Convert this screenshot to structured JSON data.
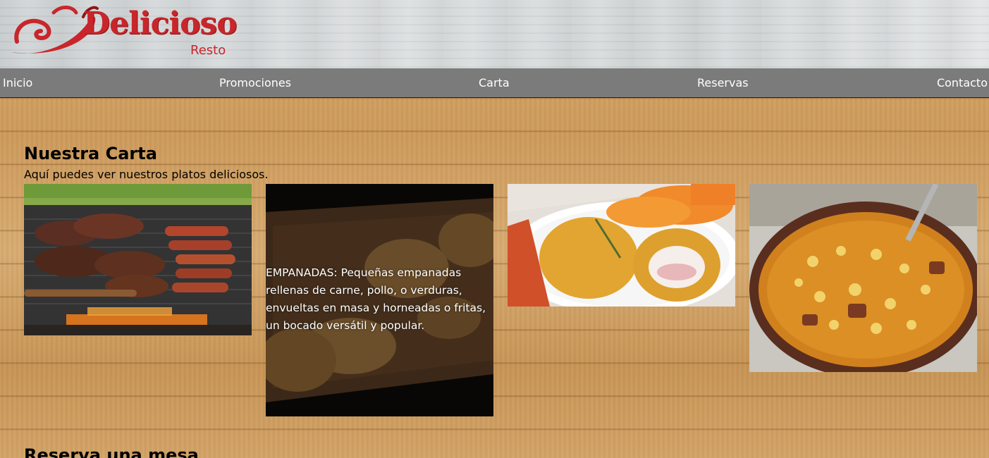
{
  "brand": {
    "name": "Delicioso",
    "tagline": "Resto",
    "color": "#c8262b"
  },
  "nav": {
    "items": [
      {
        "label": "Inicio"
      },
      {
        "label": "Promociones"
      },
      {
        "label": "Carta"
      },
      {
        "label": "Reservas"
      },
      {
        "label": "Contacto"
      }
    ]
  },
  "menu_section": {
    "title": "Nuestra Carta",
    "subtitle": "Aquí puedes ver nuestros platos deliciosos.",
    "dishes": [
      {
        "image": "asado-grill-photo"
      },
      {
        "image": "empanadas-photo",
        "caption": "EMPANADAS: Pequeñas empanadas rellenas de carne, pollo, o verduras, envueltas en masa y horneadas o fritas, un bocado versátil y popular."
      },
      {
        "image": "milanesa-photo"
      },
      {
        "image": "locro-photo"
      }
    ]
  },
  "reserve_section": {
    "title": "Reserva una mesa"
  }
}
